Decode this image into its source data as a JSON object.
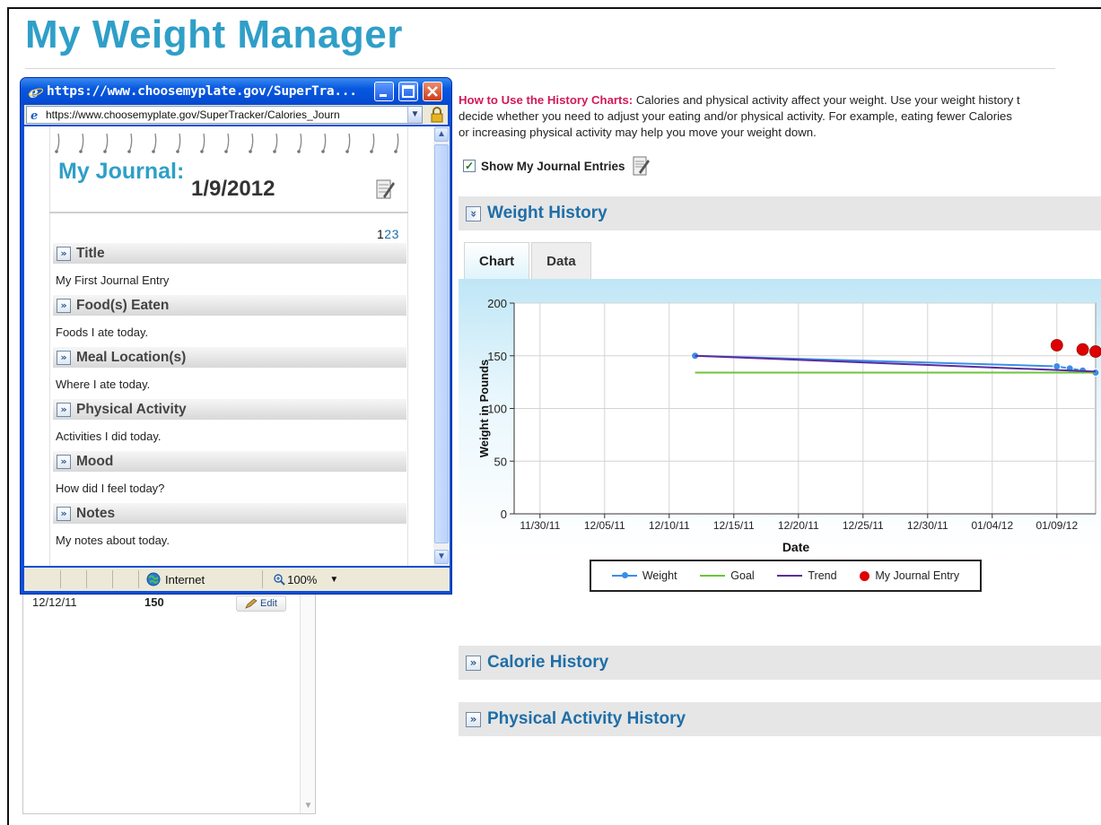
{
  "page": {
    "title": "My Weight Manager"
  },
  "howto": {
    "lead": "How to Use the History Charts:",
    "line1": " Calories and physical activity affect your weight. Use your weight history t",
    "line2": "decide whether you need to adjust your eating and/or physical activity. For example, eating fewer Calories",
    "line3": "or increasing physical activity may help you move your weight down."
  },
  "show_entries": {
    "label": "Show My Journal Entries",
    "checked": true,
    "check_glyph": "✓"
  },
  "sections": {
    "weight": "Weight History",
    "calorie": "Calorie History",
    "activity": "Physical Activity History",
    "expanded_glyph": "»",
    "collapsed_glyph": "»"
  },
  "tabs": {
    "chart": "Chart",
    "data": "Data"
  },
  "chart_data": {
    "type": "line",
    "xlabel": "Date",
    "ylabel": "Weight in Pounds",
    "ylim": [
      0,
      200
    ],
    "y_ticks": [
      "0",
      "50",
      "100",
      "150",
      "200"
    ],
    "x_ticks": [
      "11/30/11",
      "12/05/11",
      "12/10/11",
      "12/15/11",
      "12/20/11",
      "12/25/11",
      "12/30/11",
      "01/04/12",
      "01/09/12"
    ],
    "x_start": "11/28/11",
    "x_end": "01/12/12",
    "grid": true,
    "series": [
      {
        "name": "Weight",
        "color": "#3b8ee8",
        "marker": true,
        "x": [
          "12/12/11",
          "01/09/12",
          "01/10/12",
          "01/11/12",
          "01/12/12"
        ],
        "values": [
          150,
          140,
          138,
          136,
          134
        ]
      },
      {
        "name": "Goal",
        "color": "#6cc43c",
        "marker": false,
        "x": [
          "12/12/11",
          "01/12/12"
        ],
        "values": [
          134,
          134
        ]
      },
      {
        "name": "Trend",
        "color": "#5b2c9e",
        "marker": false,
        "x": [
          "12/12/11",
          "01/12/12"
        ],
        "values": [
          150,
          135
        ]
      },
      {
        "name": "My Journal Entry",
        "color": "#dd0000",
        "marker": true,
        "x": [
          "01/09/12",
          "01/11/12",
          "01/12/12"
        ],
        "values": [
          160,
          156,
          154
        ]
      }
    ],
    "legend": [
      "Weight",
      "Goal",
      "Trend",
      "My Journal Entry"
    ],
    "legend_position": "bottom"
  },
  "list": {
    "row_date": "12/12/11",
    "row_weight": "150",
    "edit_label": "Edit"
  },
  "popup": {
    "window_title": "https://www.choosemyplate.gov/SuperTra...",
    "address": "https://www.choosemyplate.gov/SuperTracker/Calories_Journ",
    "journal_title": "My Journal:",
    "journal_date": "1/9/2012",
    "pages": [
      "1",
      "2",
      "3"
    ],
    "current_page": "1",
    "entries": [
      {
        "heading": "Title",
        "text": "My First Journal Entry"
      },
      {
        "heading": "Food(s) Eaten",
        "text": "Foods I ate today."
      },
      {
        "heading": "Meal Location(s)",
        "text": "Where I ate today."
      },
      {
        "heading": "Physical Activity",
        "text": "Activities I did today."
      },
      {
        "heading": "Mood",
        "text": "How did I feel today?"
      },
      {
        "heading": "Notes",
        "text": "My notes about today."
      }
    ],
    "status_zone": "Internet",
    "zoom": "100%"
  },
  "colors": {
    "brand_title": "#2f9fc8",
    "section_link": "#1f6ea8",
    "howto_lead": "#d2185a",
    "xp_title_blue": "#0758e0"
  }
}
